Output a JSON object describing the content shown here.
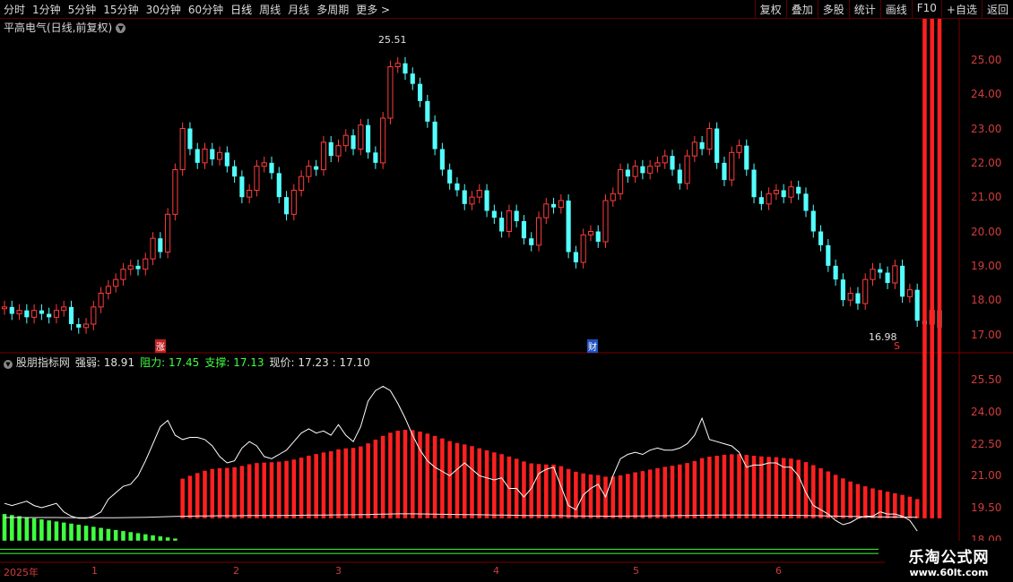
{
  "toolbar": {
    "periods": [
      "分时",
      "1分钟",
      "5分钟",
      "15分钟",
      "30分钟",
      "60分钟",
      "日线",
      "周线",
      "月线",
      "多周期",
      "更多 >"
    ],
    "active_period": "日线",
    "buttons": [
      "复权",
      "叠加",
      "多股",
      "统计",
      "画线",
      "F10",
      "+自选",
      "返回"
    ]
  },
  "main_title": "平高电气(日线,前复权)",
  "indicator": {
    "name": "股朋指标网",
    "qiangruo_label": "强弱:",
    "qiangruo_value": "18.91",
    "zuli_label": "阻力:",
    "zuli_value": "17.45",
    "zhicheng_label": "支撑:",
    "zhicheng_value": "17.13",
    "xianjia_label": "现价:",
    "xianjia_value": "17.23 : 17.10"
  },
  "colors": {
    "up": "#ff3c3c",
    "down": "#54ffff",
    "resist": "#ff2020",
    "support": "#40ff40",
    "white": "#ffffff",
    "axis": "#d23c3c"
  },
  "chart_data": {
    "type": "candlestick",
    "ylim_main": [
      16.7,
      25.7
    ],
    "ylim_indicator": [
      17.9,
      26.1
    ],
    "yticks_main": [
      "25.00",
      "24.00",
      "23.00",
      "22.00",
      "21.00",
      "20.00",
      "19.00",
      "18.00",
      "17.00"
    ],
    "yticks_indicator": [
      "25.50",
      "24.00",
      "22.50",
      "21.00",
      "19.50",
      "18.00"
    ],
    "x_labels": [
      "2025年",
      "1",
      "2",
      "3",
      "4",
      "5",
      "6"
    ],
    "high_annotation": "25.51",
    "low_annotation": "16.98",
    "markers": [
      "涨",
      "财",
      "S"
    ],
    "close": [
      17.8,
      17.6,
      17.7,
      17.5,
      17.7,
      17.6,
      17.5,
      17.7,
      17.8,
      17.3,
      17.2,
      17.3,
      17.8,
      18.2,
      18.4,
      18.6,
      18.9,
      19.0,
      18.9,
      19.2,
      19.8,
      19.4,
      20.5,
      21.8,
      23.0,
      22.4,
      22.0,
      22.4,
      22.1,
      22.3,
      21.9,
      21.6,
      21.0,
      21.2,
      21.9,
      22.0,
      21.7,
      21.0,
      20.5,
      21.2,
      21.6,
      21.9,
      21.8,
      22.6,
      22.2,
      22.5,
      22.8,
      22.4,
      23.1,
      22.3,
      22.0,
      23.3,
      24.8,
      24.9,
      24.6,
      24.3,
      23.8,
      23.2,
      22.4,
      21.8,
      21.4,
      21.2,
      20.8,
      21.0,
      21.2,
      20.6,
      20.4,
      20.0,
      20.6,
      20.3,
      19.8,
      19.6,
      20.4,
      20.8,
      20.7,
      20.9,
      19.4,
      19.1,
      19.9,
      20.0,
      19.7,
      20.9,
      21.1,
      21.8,
      21.6,
      21.9,
      21.7,
      21.9,
      22.0,
      22.2,
      21.8,
      21.4,
      22.2,
      22.6,
      22.4,
      23.0,
      22.0,
      21.5,
      22.3,
      22.5,
      21.8,
      21.0,
      20.8,
      21.1,
      21.2,
      21.0,
      21.3,
      21.1,
      20.6,
      20.0,
      19.6,
      19.0,
      18.6,
      18.0,
      18.2,
      17.9,
      18.6,
      18.9,
      18.8,
      18.5,
      19.0,
      18.1,
      18.3,
      17.4,
      17.3,
      17.7,
      17.2
    ],
    "indicator_values": [
      19.7,
      19.6,
      19.7,
      19.8,
      19.6,
      19.5,
      19.6,
      19.7,
      19.3,
      19.1,
      19.0,
      19.0,
      19.1,
      19.3,
      19.9,
      20.2,
      20.5,
      20.6,
      21.0,
      21.7,
      22.5,
      23.3,
      23.6,
      22.9,
      22.7,
      22.8,
      22.8,
      22.7,
      22.4,
      21.9,
      21.6,
      21.7,
      22.3,
      22.6,
      22.4,
      21.9,
      21.8,
      22.0,
      22.2,
      22.6,
      23.0,
      23.2,
      23.0,
      23.1,
      22.9,
      23.4,
      22.9,
      22.6,
      23.3,
      24.5,
      25.0,
      25.2,
      25.0,
      24.4,
      23.7,
      22.9,
      22.2,
      21.7,
      21.4,
      21.2,
      21.0,
      21.3,
      21.6,
      21.3,
      21.0,
      20.9,
      20.8,
      20.9,
      20.4,
      20.4,
      20.0,
      20.4,
      21.1,
      21.3,
      21.4,
      20.5,
      19.6,
      19.4,
      20.1,
      20.4,
      20.6,
      20.0,
      21.0,
      21.8,
      22.0,
      22.1,
      22.0,
      22.2,
      22.3,
      22.2,
      22.2,
      22.3,
      22.5,
      22.9,
      23.7,
      22.7,
      22.6,
      22.5,
      22.4,
      22.1,
      21.4,
      21.5,
      21.5,
      21.6,
      21.6,
      21.4,
      21.4,
      21.0,
      20.2,
      19.6,
      19.4,
      19.2,
      18.9,
      18.7,
      18.8,
      19.0,
      19.1,
      19.1,
      19.3,
      19.2,
      19.2,
      19.1,
      18.9,
      18.4
    ]
  },
  "watermark": {
    "title": "乐淘公式网",
    "url": "www.60lt.com"
  }
}
